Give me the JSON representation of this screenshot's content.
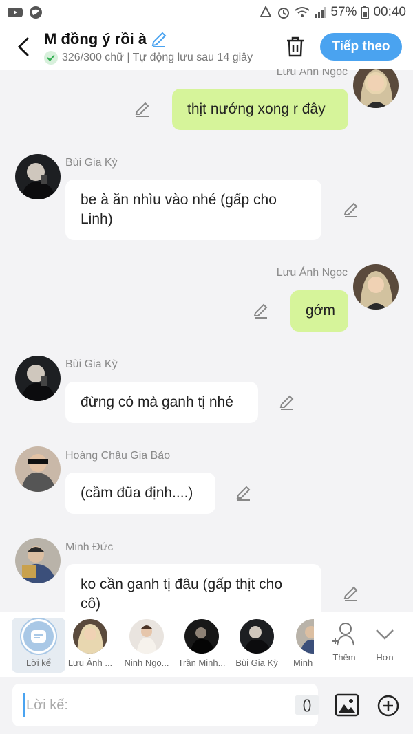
{
  "status_bar": {
    "battery": "57%",
    "time": "00:40"
  },
  "header": {
    "title": "M đồng ý rồi à",
    "subtitle": "326/300 chữ | Tự động lưu sau 14 giây",
    "next_label": "Tiếp theo"
  },
  "messages": [
    {
      "name": "Lưu Ánh Ngọc",
      "text": "thịt nướng xong r đây"
    },
    {
      "name": "Bùi Gia Kỳ",
      "text": "be à ăn nhìu vào nhé (gấp cho Linh)"
    },
    {
      "name": "Lưu Ánh Ngọc",
      "text": "gớm"
    },
    {
      "name": "Bùi Gia Kỳ",
      "text": "đừng có mà ganh tị nhé"
    },
    {
      "name": "Hoàng Châu Gia Bảo",
      "text": "(cầm đũa định....)"
    },
    {
      "name": "Minh Đức",
      "text": "ko cần ganh tị đâu (gấp thịt cho cô)"
    }
  ],
  "characters": {
    "narrator": "Lời kể",
    "items": [
      "Lưu Ánh ...",
      "Ninh Ngọ...",
      "Trần Minh...",
      "Bùi Gia Kỳ",
      "Minh"
    ],
    "add_label": "Thêm",
    "more_label": "Hơn"
  },
  "input": {
    "placeholder": "Lời kể:",
    "paren_label": "()"
  },
  "colors": {
    "accent": "#4aa3f0",
    "my_bubble": "#d6f49a",
    "their_bubble": "#ffffff"
  }
}
